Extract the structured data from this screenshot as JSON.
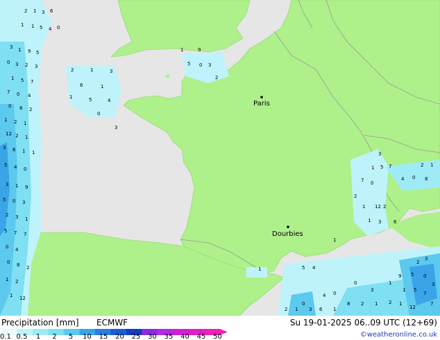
{
  "map": {
    "cities": [
      {
        "name": "Paris",
        "value": ""
      },
      {
        "name": "Dourbies",
        "value": ""
      }
    ],
    "precip_values": [
      "0",
      "1",
      "1",
      "2",
      "0",
      "1",
      "3",
      "4",
      "1",
      "5",
      "1",
      "3",
      "2",
      "1",
      "0",
      "5",
      "7",
      "3",
      "2",
      "1",
      "9",
      "8",
      "4",
      "7",
      "6",
      "3",
      "12",
      "5",
      "2",
      "0"
    ]
  },
  "footer": {
    "title": "Precipitation [mm]",
    "model": "ECMWF",
    "valid_time": "Su 19-01-2025 06..09 UTC (12+69)",
    "credit": "©weatheronline.co.uk"
  },
  "legend": {
    "labels": [
      "0.1",
      "0.5",
      "1",
      "2",
      "5",
      "10",
      "15",
      "20",
      "25",
      "30",
      "35",
      "40",
      "45",
      "50"
    ],
    "colors": [
      "#e8fbff",
      "#bff3fb",
      "#9eebf7",
      "#7fdff3",
      "#5cc9ee",
      "#3aa4e8",
      "#2a7fe0",
      "#1c5bd6",
      "#123dbb",
      "#8a2be2",
      "#b02ce0",
      "#d21fd6",
      "#e21ec8",
      "#ee20b5"
    ]
  },
  "colors": {
    "land": "#aef08a",
    "sea": "#e6e6e6",
    "border": "#9a9a9a"
  }
}
